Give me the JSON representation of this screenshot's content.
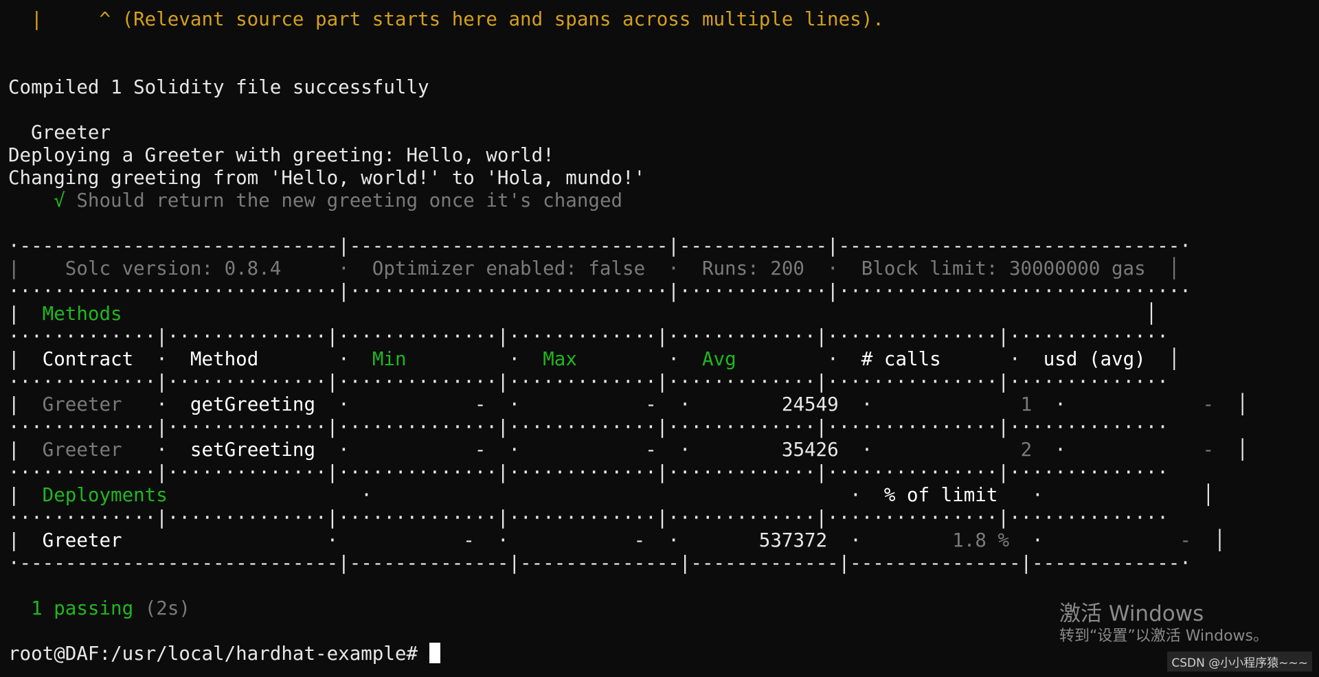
{
  "terminal": {
    "lines": [
      {
        "text": "  |     ^ (Relevant source part starts here and spans across multiple lines).",
        "color": "#d4a017"
      },
      {
        "text": "Compiled 1 Solidity file successfully",
        "color": "#e8e8e8"
      },
      {
        "text": "  Greeter",
        "color": "#e8e8e8"
      },
      {
        "text": "Deploying a Greeter with greeting: Hello, world!",
        "color": "#e8e8e8"
      },
      {
        "text": "Changing greeting from 'Hello, world!' to 'Hola, mundo!'",
        "color": "#e8e8e8"
      }
    ],
    "test_check": "√",
    "test_label": "Should return the new greeting once it's changed",
    "gas_table": {
      "top_border": "·----------------------------|----------------------------|-------------|------------------------------·",
      "header_row": "|    Solc version: 0.8.4     ·  Optimizer enabled: false  ·  Runs: 200  ·  Block limit: 30000000 gas  │",
      "sep_full": "·····························|····························|·············|·······························",
      "methods_left": "|  ",
      "methods_label": "Methods",
      "methods_right": "                                                                                          │",
      "sep_cols": "·············|··············|··············|·············|·············|···············|··············",
      "col_header_parts": [
        {
          "text": "|  ",
          "color": "#e8e8e8"
        },
        {
          "text": "Contract",
          "color": "#ffffff"
        },
        {
          "text": "  ·  ",
          "color": "#e8e8e8"
        },
        {
          "text": "Method",
          "color": "#ffffff"
        },
        {
          "text": "       ·  ",
          "color": "#e8e8e8"
        },
        {
          "text": "Min",
          "color": "#1fb71f"
        },
        {
          "text": "         ·  ",
          "color": "#e8e8e8"
        },
        {
          "text": "Max",
          "color": "#1fb71f"
        },
        {
          "text": "        ·  ",
          "color": "#e8e8e8"
        },
        {
          "text": "Avg",
          "color": "#1fb71f"
        },
        {
          "text": "        ·  ",
          "color": "#e8e8e8"
        },
        {
          "text": "# calls",
          "color": "#ffffff"
        },
        {
          "text": "      ·  ",
          "color": "#e8e8e8"
        },
        {
          "text": "usd (avg)",
          "color": "#ffffff"
        },
        {
          "text": "  │",
          "color": "#e8e8e8"
        }
      ],
      "rows": [
        {
          "contract": "Greeter",
          "method": "getGreeting",
          "min": "-",
          "max": "-",
          "avg": "24549",
          "calls": "1",
          "usd": "-"
        },
        {
          "contract": "Greeter",
          "method": "setGreeting",
          "min": "-",
          "max": "-",
          "avg": "35426",
          "calls": "2",
          "usd": "-"
        }
      ],
      "deployments_label": "Deployments",
      "pct_limit_label": "% of limit",
      "deploy_row": {
        "contract": "Greeter",
        "min": "-",
        "max": "-",
        "avg": "537372",
        "pct": "1.8 %",
        "usd": "-"
      },
      "bottom_border": "·----------------------------|--------------|--------------|-------------|---------------|-------------·"
    },
    "passing_count": "1 passing",
    "passing_time": "(2s)",
    "prompt": "root@DAF:/usr/local/hardhat-example# "
  },
  "watermark": {
    "title": "激活 Windows",
    "subtitle": "转到“设置”以激活 Windows。",
    "csdn": "CSDN @小小程序猿~~~"
  }
}
